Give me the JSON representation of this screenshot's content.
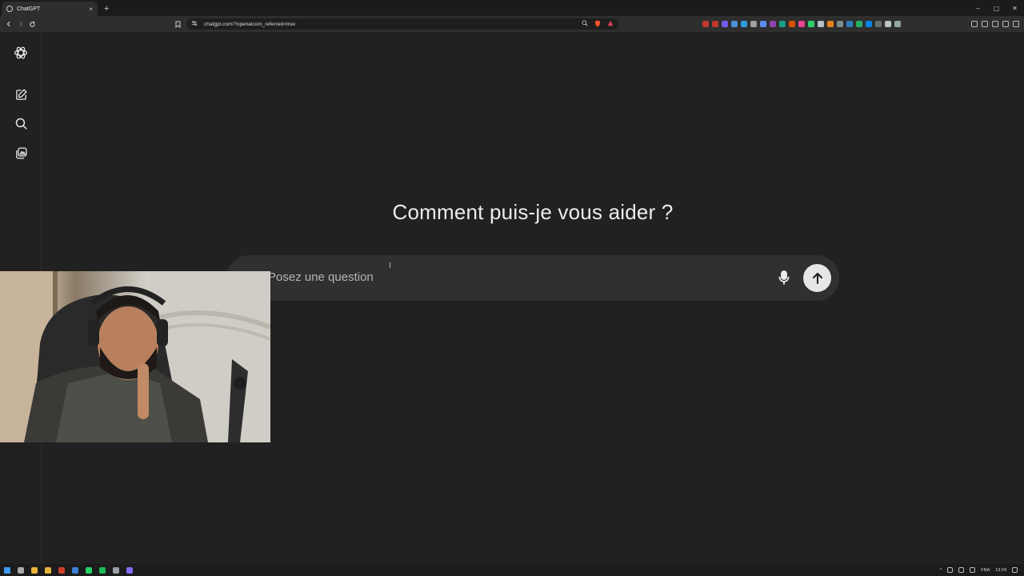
{
  "browser": {
    "tab_title": "ChatGPT",
    "tab_close": "×",
    "new_tab": "+",
    "url": "chatgpt.com/?openaicom_referred=true",
    "window_controls": [
      "–",
      "▢",
      "✕"
    ],
    "extension_colors": [
      "#c0392b",
      "#c0392b",
      "#6c5ce7",
      "#4a90d9",
      "#2d9cdb",
      "#9e9e9e",
      "#5b8def",
      "#8e44ad",
      "#16a085",
      "#d35400",
      "#e84393",
      "#2ecc71",
      "#b2bec3",
      "#e67e22",
      "#7f8c8d",
      "#2980b9",
      "#27ae60",
      "#0984e3",
      "#636e72",
      "#bdc3c7",
      "#95a5a6"
    ]
  },
  "sidebar": {
    "items": [
      {
        "name": "chatgpt-logo-icon"
      },
      {
        "name": "new-chat-icon"
      },
      {
        "name": "search-icon"
      },
      {
        "name": "library-icon"
      }
    ]
  },
  "main": {
    "heading": "Comment puis-je vous aider ?",
    "composer": {
      "placeholder": "Posez une question",
      "mic_icon": "microphone-icon",
      "send_icon": "arrow-up-icon"
    }
  },
  "taskbar": {
    "app_colors": [
      "#3c9bf0",
      "#aaaaaa",
      "#e7b33a",
      "#e7b33a",
      "#d0402c",
      "#3a7fd6",
      "#25d366",
      "#1db954",
      "#9aa0a6",
      "#7f6ef5"
    ],
    "language": "FRA",
    "time": "13:24"
  }
}
